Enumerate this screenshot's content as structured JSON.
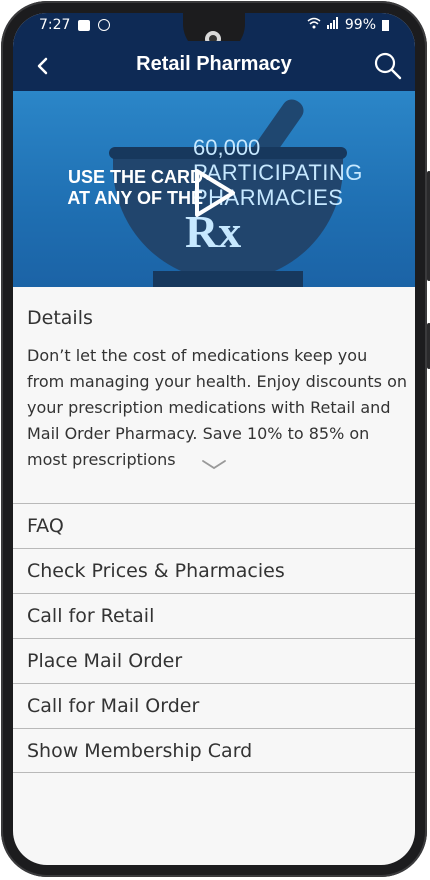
{
  "status": {
    "time": "7:27",
    "battery": "99%"
  },
  "header": {
    "title": "Retail Pharmacy"
  },
  "video": {
    "caption_left": "USE THE CARD AT ANY OF THE",
    "caption_line1": "60,000",
    "caption_line2": "PARTICIPATING",
    "caption_line3": "PHARMACIES",
    "rx": "Rx"
  },
  "details": {
    "title": "Details",
    "body": "Don’t let the cost of medications keep you from managing your health. Enjoy discounts on your prescription medications with Retail and Mail Order Pharmacy. Save 10% to 85% on most prescriptions"
  },
  "menu": [
    {
      "label": "FAQ"
    },
    {
      "label": "Check Prices & Pharmacies"
    },
    {
      "label": "Call for Retail"
    },
    {
      "label": "Place Mail Order"
    },
    {
      "label": "Call for Mail Order"
    },
    {
      "label": "Show Membership Card"
    }
  ],
  "colors": {
    "header": "#0e2a55",
    "video_bg": "#2b86c8"
  }
}
